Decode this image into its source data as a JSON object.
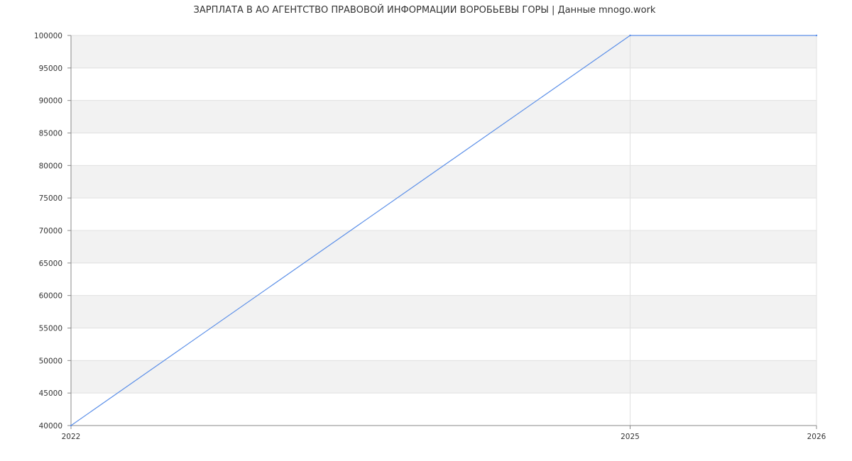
{
  "chart_data": {
    "type": "line",
    "title": "ЗАРПЛАТА В АО АГЕНТСТВО ПРАВОВОЙ ИНФОРМАЦИИ ВОРОБЬЕВЫ ГОРЫ | Данные mnogo.work",
    "x": [
      2022,
      2025,
      2026
    ],
    "series": [
      {
        "values": [
          40000,
          100000,
          100000
        ]
      }
    ],
    "xlim": [
      2022,
      2026
    ],
    "ylim": [
      40000,
      100000
    ],
    "x_ticks": [
      "2022",
      "2025",
      "2026"
    ],
    "y_ticks": [
      "100000",
      "95000",
      "90000",
      "85000",
      "80000",
      "75000",
      "70000",
      "65000",
      "60000",
      "55000",
      "50000",
      "45000",
      "40000"
    ],
    "grid": true,
    "alternating_bands": true,
    "legend": "none",
    "colors": {
      "line": "#5b8fe8",
      "band": "#f2f2f2",
      "grid": "#e0e0e0",
      "axis": "#888888",
      "text": "#333333"
    }
  }
}
